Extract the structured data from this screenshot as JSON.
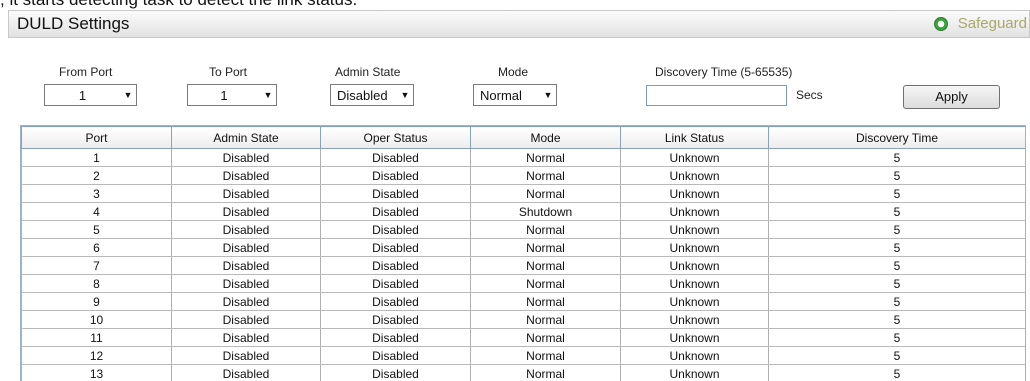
{
  "caption": "; it starts detecting task to detect the link status.",
  "header": {
    "title": "DULD Settings",
    "safeguard_label": "Safeguard"
  },
  "form": {
    "from_port_label": "From Port",
    "to_port_label": "To Port",
    "admin_state_label": "Admin State",
    "mode_label": "Mode",
    "discovery_time_label": "Discovery Time (5-65535)",
    "from_port_value": "1",
    "to_port_value": "1",
    "admin_state_value": "Disabled",
    "mode_value": "Normal",
    "discovery_time_value": "",
    "secs_label": "Secs",
    "apply_label": "Apply"
  },
  "table": {
    "columns": [
      "Port",
      "Admin State",
      "Oper Status",
      "Mode",
      "Link Status",
      "Discovery Time"
    ],
    "rows": [
      [
        "1",
        "Disabled",
        "Disabled",
        "Normal",
        "Unknown",
        "5"
      ],
      [
        "2",
        "Disabled",
        "Disabled",
        "Normal",
        "Unknown",
        "5"
      ],
      [
        "3",
        "Disabled",
        "Disabled",
        "Normal",
        "Unknown",
        "5"
      ],
      [
        "4",
        "Disabled",
        "Disabled",
        "Shutdown",
        "Unknown",
        "5"
      ],
      [
        "5",
        "Disabled",
        "Disabled",
        "Normal",
        "Unknown",
        "5"
      ],
      [
        "6",
        "Disabled",
        "Disabled",
        "Normal",
        "Unknown",
        "5"
      ],
      [
        "7",
        "Disabled",
        "Disabled",
        "Normal",
        "Unknown",
        "5"
      ],
      [
        "8",
        "Disabled",
        "Disabled",
        "Normal",
        "Unknown",
        "5"
      ],
      [
        "9",
        "Disabled",
        "Disabled",
        "Normal",
        "Unknown",
        "5"
      ],
      [
        "10",
        "Disabled",
        "Disabled",
        "Normal",
        "Unknown",
        "5"
      ],
      [
        "11",
        "Disabled",
        "Disabled",
        "Normal",
        "Unknown",
        "5"
      ],
      [
        "12",
        "Disabled",
        "Disabled",
        "Normal",
        "Unknown",
        "5"
      ],
      [
        "13",
        "Disabled",
        "Disabled",
        "Normal",
        "Unknown",
        "5"
      ]
    ]
  }
}
